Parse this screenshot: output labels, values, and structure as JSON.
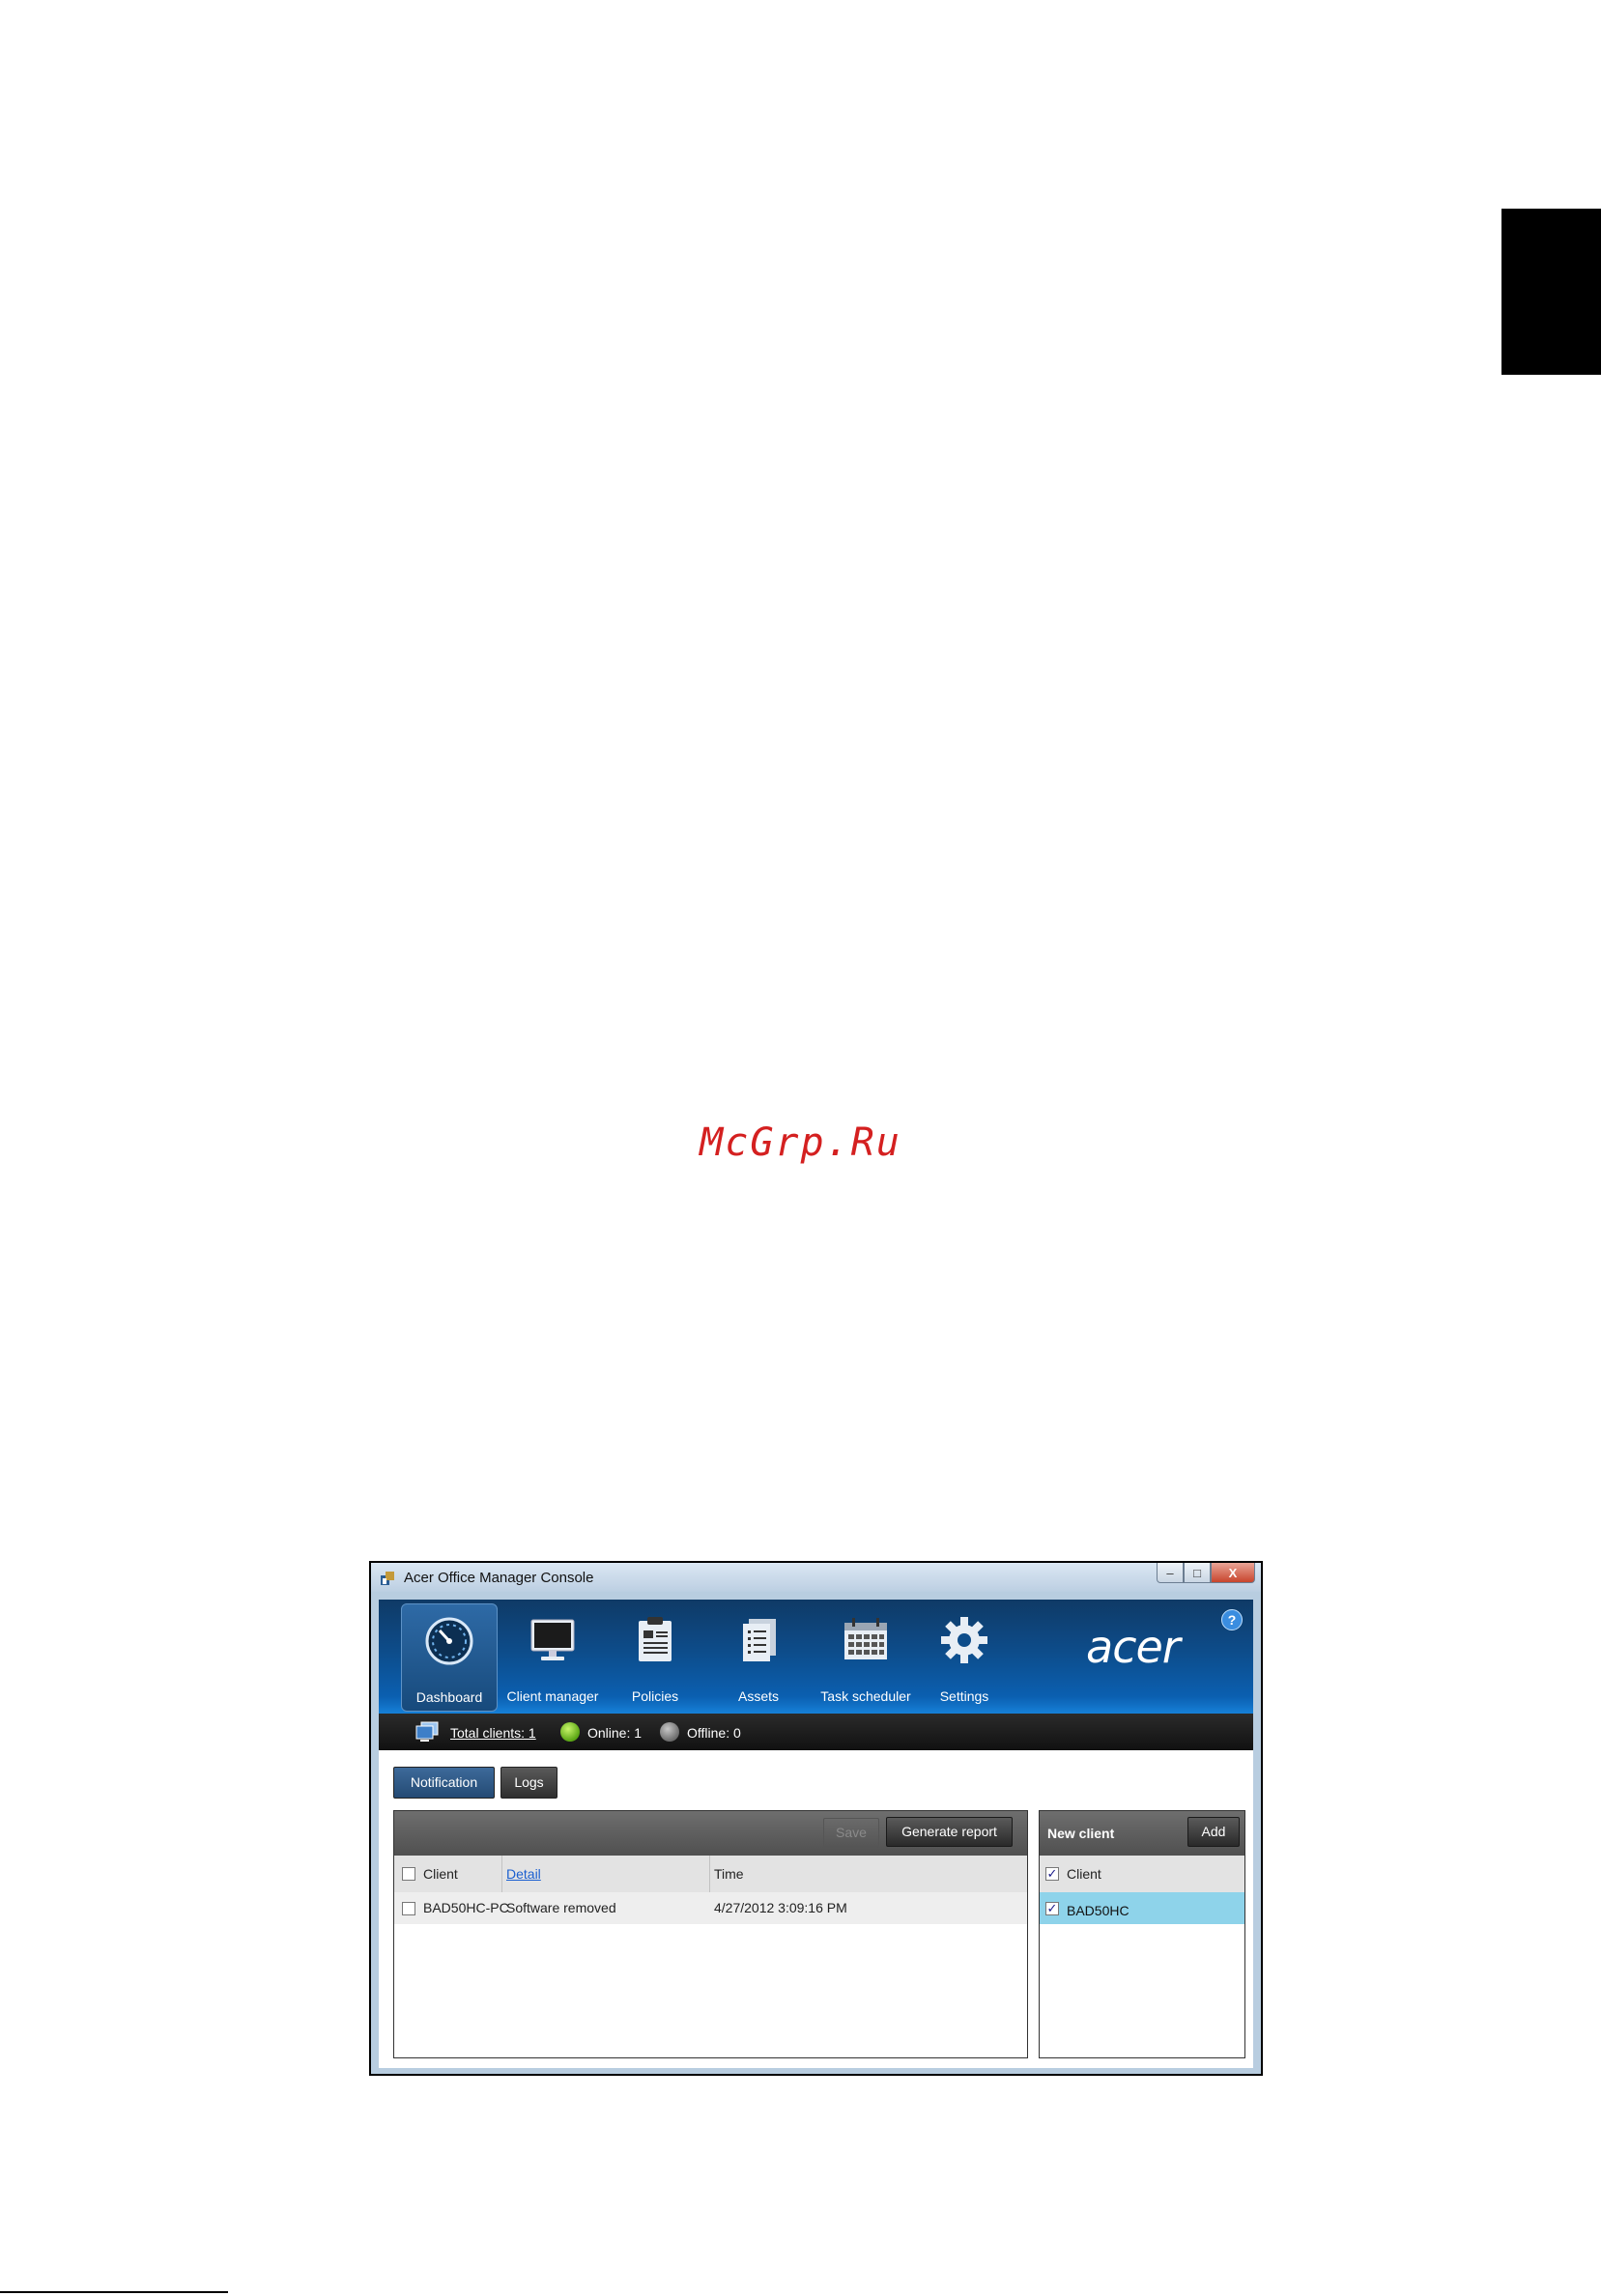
{
  "page": {
    "watermark": "McGrp.Ru"
  },
  "window": {
    "title": "Acer Office Manager Console",
    "caption_buttons": {
      "minimize": "–",
      "maximize": "□",
      "close": "X"
    }
  },
  "nav": {
    "items": [
      {
        "label": "Dashboard",
        "icon": "speedometer-icon",
        "active": true
      },
      {
        "label": "Client manager",
        "icon": "monitor-icon"
      },
      {
        "label": "Policies",
        "icon": "clipboard-icon"
      },
      {
        "label": "Assets",
        "icon": "document-list-icon"
      },
      {
        "label": "Task scheduler",
        "icon": "calendar-icon"
      },
      {
        "label": "Settings",
        "icon": "gear-icon"
      }
    ],
    "brand": "acer",
    "help": "?"
  },
  "status": {
    "total_clients": "Total clients: 1",
    "online": "Online: 1",
    "offline": "Offline: 0",
    "online_color": "#6bbd1b",
    "offline_color": "#7a7a7a"
  },
  "tabs": {
    "notification": "Notification",
    "logs": "Logs"
  },
  "notifications": {
    "save_label": "Save",
    "report_label": "Generate report",
    "columns": {
      "client": "Client",
      "detail": "Detail",
      "time": "Time"
    },
    "rows": [
      {
        "client": "BAD50HC-PC",
        "detail": "Software removed",
        "time": "4/27/2012 3:09:16 PM"
      }
    ]
  },
  "new_client": {
    "title": "New client",
    "add_label": "Add",
    "column": "Client",
    "rows": [
      {
        "name": "BAD50HC",
        "checked": true
      }
    ],
    "highlight_color": "#8ed3ea"
  }
}
